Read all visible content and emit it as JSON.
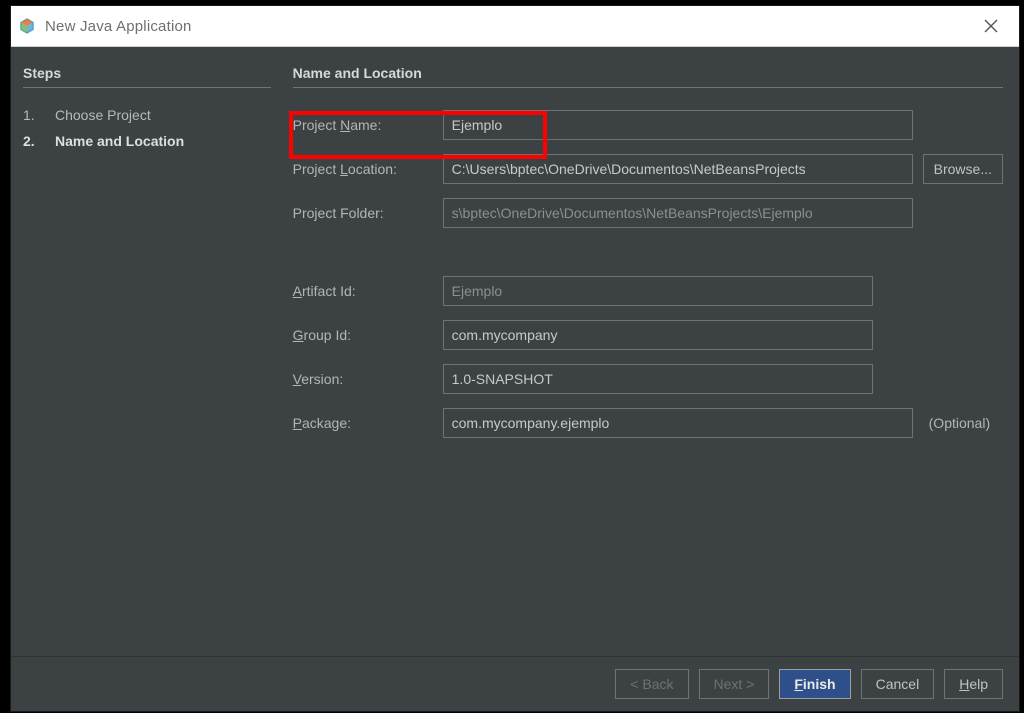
{
  "window": {
    "title": "New Java Application"
  },
  "steps": {
    "heading": "Steps",
    "items": [
      {
        "num": "1.",
        "label": "Choose Project",
        "current": false
      },
      {
        "num": "2.",
        "label": "Name and Location",
        "current": true
      }
    ]
  },
  "form": {
    "heading": "Name and Location",
    "projectNameLabel": "Project Name:",
    "projectNameMnemonicIndex": 8,
    "projectName": "Ejemplo",
    "projectLocationLabel": "Project Location:",
    "projectLocation": "C:\\Users\\bptec\\OneDrive\\Documentos\\NetBeansProjects",
    "browseLabel": "Browse...",
    "projectFolderLabel": "Project Folder:",
    "projectFolder": "s\\bptec\\OneDrive\\Documentos\\NetBeansProjects\\Ejemplo",
    "artifactIdLabel": "Artifact Id:",
    "artifactId": "Ejemplo",
    "groupIdLabel": "Group Id:",
    "groupId": "com.mycompany",
    "versionLabel": "Version:",
    "version": "1.0-SNAPSHOT",
    "packageLabel": "Package:",
    "package": "com.mycompany.ejemplo",
    "optional": "(Optional)"
  },
  "footer": {
    "back": "< Back",
    "next": "Next >",
    "finish": "Finish",
    "cancel": "Cancel",
    "help": "Help"
  }
}
